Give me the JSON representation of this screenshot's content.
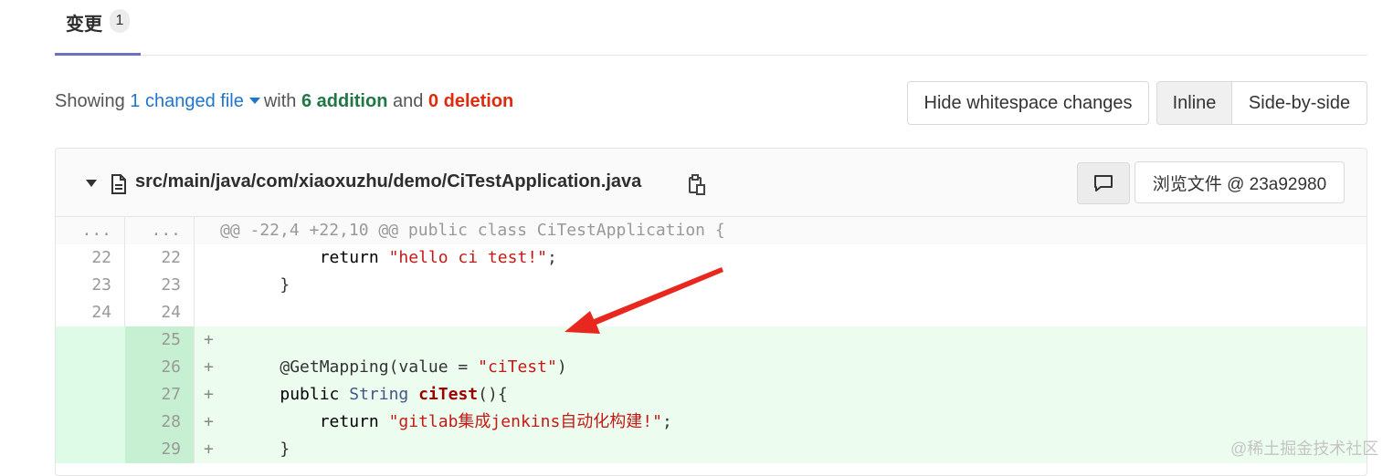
{
  "tabs": [
    {
      "label": "变更",
      "count": "1"
    }
  ],
  "summary": {
    "prefix": "Showing",
    "changed_files": "1 changed file",
    "with": "with",
    "additions": "6 addition",
    "and": "and",
    "deletions": "0 deletion"
  },
  "controls": {
    "hide_whitespace": "Hide whitespace changes",
    "inline": "Inline",
    "side_by_side": "Side-by-side"
  },
  "file": {
    "path": "src/main/java/com/xiaoxuzhu/demo/CiTestApplication.java",
    "view_file": "浏览文件 @ 23a92980"
  },
  "diff": {
    "meta": {
      "old": "...",
      "new": "...",
      "text": "@@ -22,4 +22,10 @@ public class CiTestApplication {"
    },
    "lines": [
      {
        "old": "22",
        "new": "22",
        "type": "context"
      },
      {
        "old": "23",
        "new": "23",
        "type": "context"
      },
      {
        "old": "24",
        "new": "24",
        "type": "context"
      },
      {
        "old": "",
        "new": "25",
        "type": "added"
      },
      {
        "old": "",
        "new": "26",
        "type": "added"
      },
      {
        "old": "",
        "new": "27",
        "type": "added"
      },
      {
        "old": "",
        "new": "28",
        "type": "added"
      },
      {
        "old": "",
        "new": "29",
        "type": "added"
      }
    ],
    "added_marker": "+",
    "code": {
      "l22_kw": "return",
      "l22_str": "\"hello ci test!\"",
      "l22_end": ";",
      "l23": "}",
      "l26_ann": "@GetMapping(value = ",
      "l26_str": "\"ciTest\"",
      "l26_end": ")",
      "l27_kw": "public",
      "l27_type": "String",
      "l27_fn": "ciTest",
      "l27_end": "(){",
      "l28_kw": "return",
      "l28_str": "\"gitlab集成jenkins自动化构建!\"",
      "l28_end": ";",
      "l29": "}"
    }
  },
  "watermark": "@稀土掘金技术社区",
  "colors": {
    "accent": "#6b70c0",
    "link": "#1f75cb",
    "addition": "#217645",
    "deletion": "#dd2b0e",
    "arrow": "#e8281e"
  }
}
